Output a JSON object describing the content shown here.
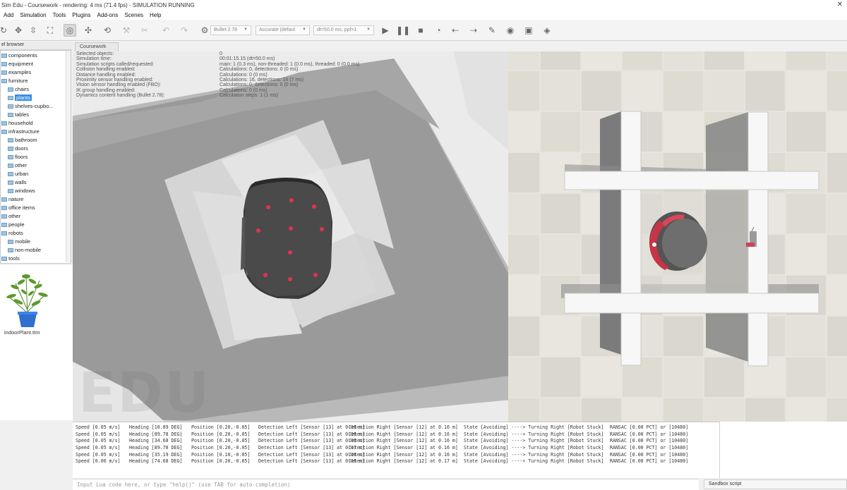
{
  "window": {
    "title": "Sim Edu - Coursework - rendering: 4 ms (71.4 fps) - SIMULATION RUNNING"
  },
  "menu": [
    "Add",
    "Simulation",
    "Tools",
    "Plugins",
    "Add-ons",
    "Scenes",
    "Help"
  ],
  "toolbar": {
    "engine": "Bullet 2.78",
    "accuracy": "Accurate (defaul",
    "timestep": "dt=50.0 ms, ppf=1"
  },
  "model_browser": {
    "title": "el browser",
    "items": [
      {
        "label": "components",
        "depth": 0,
        "selected": false
      },
      {
        "label": "equipment",
        "depth": 0,
        "selected": false
      },
      {
        "label": "examples",
        "depth": 0,
        "selected": false
      },
      {
        "label": "furniture",
        "depth": 0,
        "selected": false
      },
      {
        "label": "chairs",
        "depth": 1,
        "selected": false
      },
      {
        "label": "plants",
        "depth": 1,
        "selected": true
      },
      {
        "label": "shelves-cupbo...",
        "depth": 1,
        "selected": false
      },
      {
        "label": "tables",
        "depth": 1,
        "selected": false
      },
      {
        "label": "household",
        "depth": 0,
        "selected": false
      },
      {
        "label": "infrastructure",
        "depth": 0,
        "selected": false
      },
      {
        "label": "bathroom",
        "depth": 1,
        "selected": false
      },
      {
        "label": "doors",
        "depth": 1,
        "selected": false
      },
      {
        "label": "floors",
        "depth": 1,
        "selected": false
      },
      {
        "label": "other",
        "depth": 1,
        "selected": false
      },
      {
        "label": "urban",
        "depth": 1,
        "selected": false
      },
      {
        "label": "walls",
        "depth": 1,
        "selected": false
      },
      {
        "label": "windows",
        "depth": 1,
        "selected": false
      },
      {
        "label": "nature",
        "depth": 0,
        "selected": false
      },
      {
        "label": "office items",
        "depth": 0,
        "selected": false
      },
      {
        "label": "other",
        "depth": 0,
        "selected": false
      },
      {
        "label": "people",
        "depth": 0,
        "selected": false
      },
      {
        "label": "robots",
        "depth": 0,
        "selected": false
      },
      {
        "label": "mobile",
        "depth": 1,
        "selected": false
      },
      {
        "label": "non-mobile",
        "depth": 1,
        "selected": false
      },
      {
        "label": "tools",
        "depth": 0,
        "selected": false
      }
    ],
    "preview_label": "indoorPlant.ttm"
  },
  "scene_tab": "Coursework",
  "info_overlay": [
    {
      "key": "Selected objects:",
      "value": "0"
    },
    {
      "key": "Simulation time:",
      "value": "00:01:15.15 (dt=50.0 ms)"
    },
    {
      "key": "Simulation scripts called/requested:",
      "value": "main: 1 (0.3 ms), non-threaded: 1 (0.0 ms), threaded: 0 (0.0 ms)"
    },
    {
      "key": "Collision handling enabled:",
      "value": "Calculations: 0, detections: 0 (0 ms)"
    },
    {
      "key": "Distance handling enabled:",
      "value": "Calculations: 0 (0 ms)"
    },
    {
      "key": "Proximity sensor handling enabled:",
      "value": "Calculations: 16, detections: 16 (7 ms)"
    },
    {
      "key": "Vision sensor handling enabled (FBO):",
      "value": "Calculations: 0, detections: 0 (0 ms)"
    },
    {
      "key": "IK group handling enabled:",
      "value": "Calculations: 0 (0 ms)"
    },
    {
      "key": "Dynamics content handling (Bullet 2.78):",
      "value": "Calculation steps: 1 (1 ms)"
    }
  ],
  "watermark": "EDU",
  "console_lines": [
    [
      "Speed [0.05 m/s]",
      "Heading [10.89 DEG]",
      "Position [0.20,-0.05]",
      "Detection Left [Sensor [13] at 0.16 m]",
      "Detection Right [Sensor [12] at 0.16 m]",
      "State [Avoiding] ----> Turning Right [Robot Stuck]",
      "RANSAC [0.00 PCT] or [10480]"
    ],
    [
      "Speed [0.05 m/s]",
      "Heading [89.78 DEG]",
      "Position [0.20,-0.05]",
      "Detection Left [Sensor [13] at 0.16 m]",
      "Detection Right [Sensor [12] at 0.16 m]",
      "State [Avoiding] ----> Turning Right [Robot Stuck]",
      "RANSAC [0.00 PCT] or [10480]"
    ],
    [
      "Speed [0.05 m/s]",
      "Heading [34.68 DEG]",
      "Position [0.20,-0.05]",
      "Detection Left [Sensor [13] at 0.16 m]",
      "Detection Right [Sensor [12] at 0.16 m]",
      "State [Avoiding] ----> Turning Right [Robot Stuck]",
      "RANSAC [0.00 PCT] or [10480]"
    ],
    [
      "Speed [0.05 m/s]",
      "Heading [89.78 DEG]",
      "Position [0.20,-0.05]",
      "Detection Left [Sensor [13] at 0.17 m]",
      "Detection Right [Sensor [12] at 0.16 m]",
      "State [Avoiding] ----> Turning Right [Robot Stuck]",
      "RANSAC [0.00 PCT] or [10480]"
    ],
    [
      "Speed [0.05 m/s]",
      "Heading [35.19 DEG]",
      "Position [0.10,-0.05]",
      "Detection Left [Sensor [13] at 0.16 m]",
      "Detection Right [Sensor [12] at 0.16 m]",
      "State [Avoiding] ----> Turning Right [Robot Stuck]",
      "RANSAC [0.00 PCT] or [10480]"
    ],
    [
      "Speed [0.06 m/s]",
      "Heading [74.68 DEG]",
      "Position [0.20,-0.05]",
      "Detection Left [Sensor [13] at 0.16 m]",
      "Detection Right [Sensor [12] at 0.17 m]",
      "State [Avoiding] ----> Turning Right [Robot Stuck]",
      "RANSAC [0.00 PCT] or [10480]"
    ]
  ],
  "console_input_placeholder": "Input Lua code here, or type \"help()\" (use TAB for auto-completion)",
  "sandbox_label": "Sandbox script"
}
